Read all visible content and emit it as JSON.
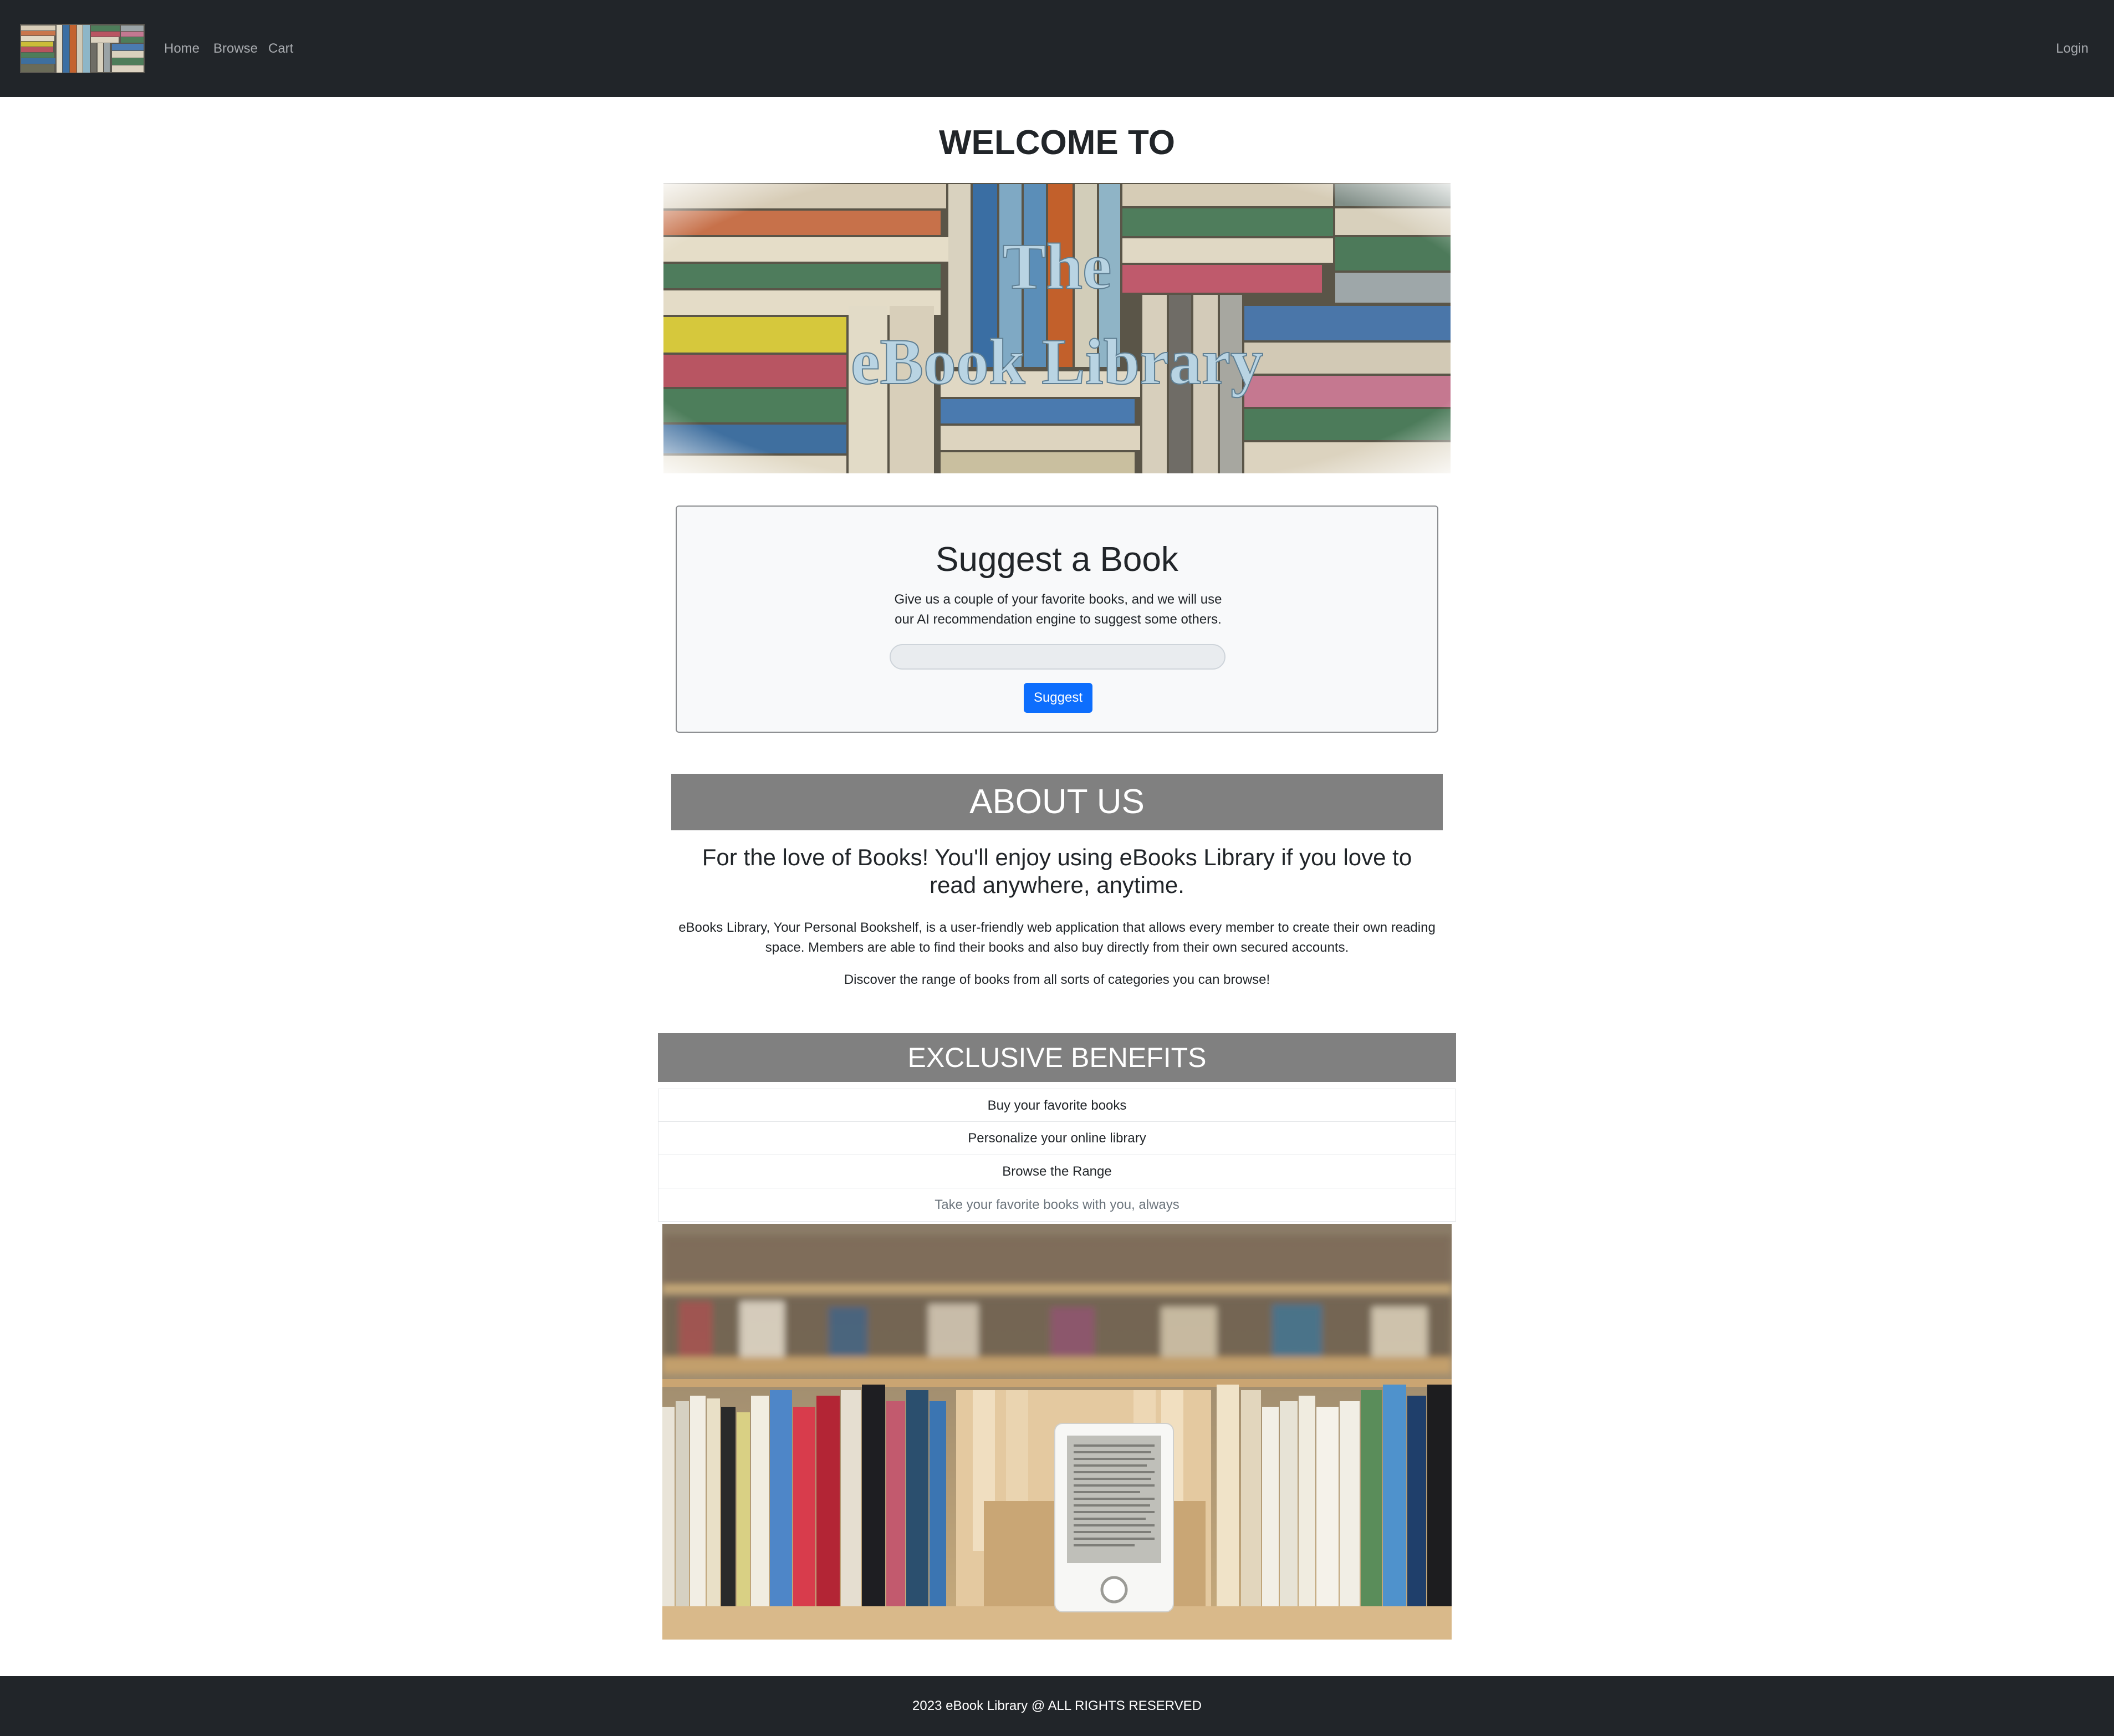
{
  "navbar": {
    "brand_logo": "bookshelf-logo",
    "links": [
      "Home",
      "Browse",
      "Cart"
    ],
    "login_label": "Login",
    "background": "#212529"
  },
  "welcome": {
    "title": "WELCOME TO",
    "hero_line1": "The",
    "hero_line2": "eBook Library"
  },
  "suggest": {
    "title": "Suggest a Book",
    "description": "Give us a couple of your favorite books, and we will use our AI recommendation engine to suggest some others.",
    "input_value": "",
    "input_placeholder": "",
    "button_label": "Suggest",
    "button_color": "#0d6efd"
  },
  "about": {
    "title": "ABOUT US",
    "lead": "For the love of Books! You'll enjoy using eBooks Library if you love to read anywhere, anytime.",
    "paragraph1": "eBooks Library, Your Personal Bookshelf, is a user-friendly web application that allows every member to create their own reading space. Members are able to find their books and also buy directly from their own secured accounts.",
    "paragraph2": "Discover the range of books from all sorts of categories you can browse!",
    "header_color": "#808080"
  },
  "benefits": {
    "title": "EXCLUSIVE BENEFITS",
    "items": [
      "Buy your favorite books",
      "Personalize your online library",
      "Browse the Range",
      "Take your favorite books with you, always"
    ],
    "image": "library-shelf-with-ereader-photo"
  },
  "footer": {
    "text": "2023 eBook Library @ ALL RIGHTS RESERVED"
  }
}
